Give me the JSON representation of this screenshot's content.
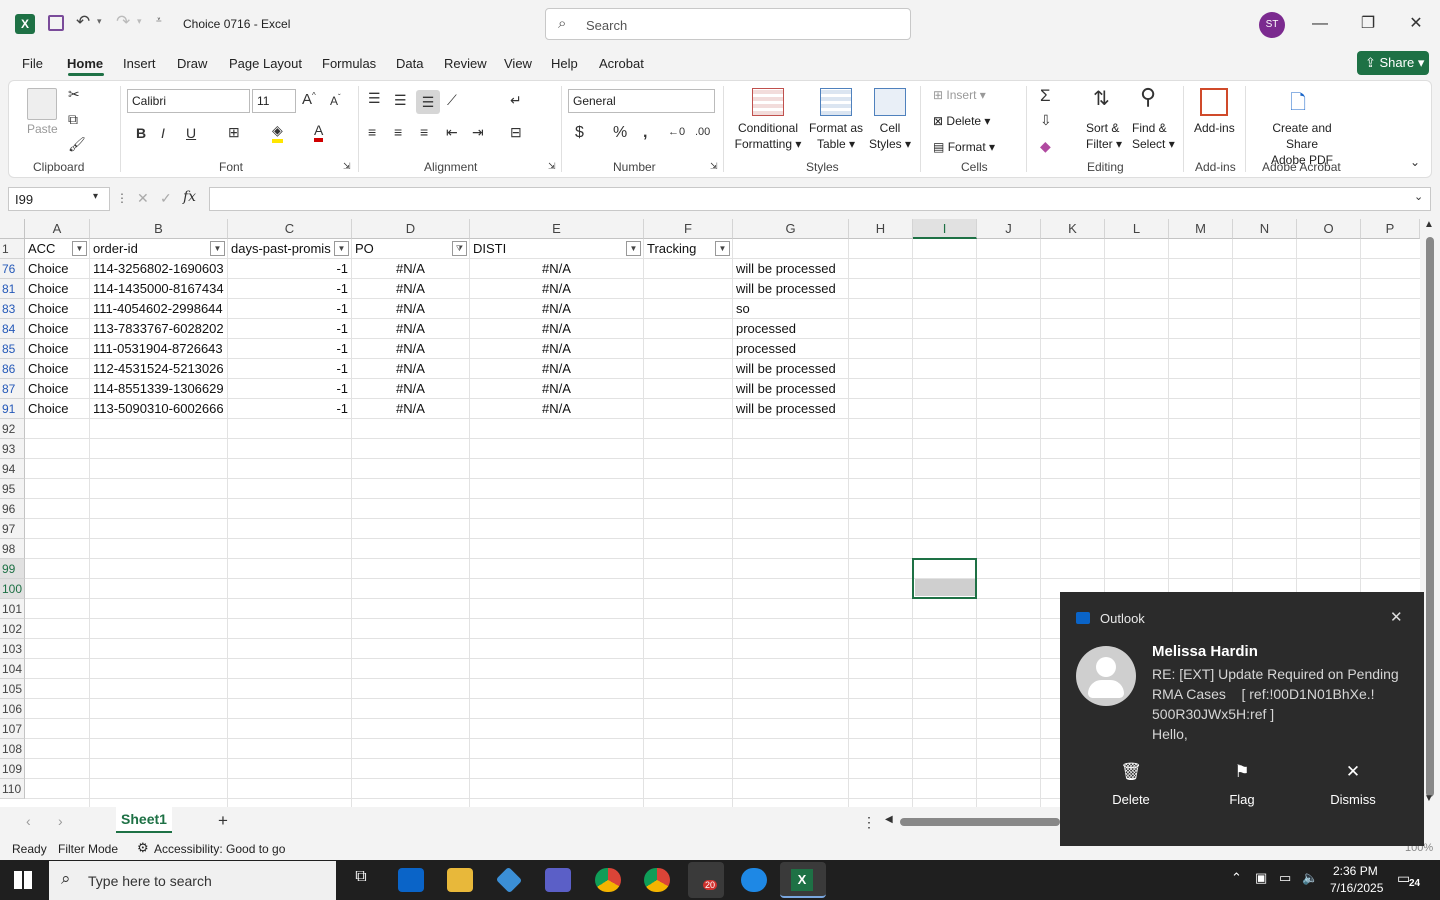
{
  "window": {
    "title": "Choice 0716  -  Excel",
    "search_placeholder": "Search",
    "user_initials": "ST"
  },
  "menu": {
    "tabs": [
      "File",
      "Home",
      "Insert",
      "Draw",
      "Page Layout",
      "Formulas",
      "Data",
      "Review",
      "View",
      "Help",
      "Acrobat"
    ],
    "share": "Share"
  },
  "ribbon": {
    "clipboard": {
      "paste": "Paste",
      "group": "Clipboard"
    },
    "font": {
      "name": "Calibri",
      "size": "11",
      "group": "Font"
    },
    "alignment": {
      "group": "Alignment"
    },
    "number": {
      "format": "General",
      "group": "Number"
    },
    "styles": {
      "conditional_1": "Conditional",
      "conditional_2": "Formatting",
      "format_table_1": "Format as",
      "format_table_2": "Table",
      "cell_styles_1": "Cell",
      "cell_styles_2": "Styles",
      "group": "Styles"
    },
    "cells": {
      "insert": "Insert",
      "delete": "Delete",
      "format": "Format",
      "group": "Cells"
    },
    "editing": {
      "sort_1": "Sort &",
      "sort_2": "Filter",
      "find_1": "Find &",
      "find_2": "Select",
      "group": "Editing"
    },
    "addins": {
      "label": "Add-ins",
      "group": "Add-ins"
    },
    "acrobat": {
      "label_1": "Create and Share",
      "label_2": "Adobe PDF",
      "group": "Adobe Acrobat"
    }
  },
  "formula_bar": {
    "name_box": "I99",
    "fx": "fx",
    "formula": ""
  },
  "columns": [
    "A",
    "B",
    "C",
    "D",
    "E",
    "F",
    "G",
    "H",
    "I",
    "J",
    "K",
    "L",
    "M",
    "N",
    "O",
    "P"
  ],
  "header_row": {
    "row": "1",
    "A": "ACC",
    "B": "order-id",
    "C": "days-past-promis",
    "D": "PO",
    "E": "DISTI",
    "F": "Tracking",
    "G": ""
  },
  "rows": [
    {
      "row": "76",
      "A": "Choice",
      "B": "114-3256802-1690603",
      "C": "-1",
      "D": "#N/A",
      "E": "#N/A",
      "F": "",
      "G": "will be processed"
    },
    {
      "row": "81",
      "A": "Choice",
      "B": "114-1435000-8167434",
      "C": "-1",
      "D": "#N/A",
      "E": "#N/A",
      "F": "",
      "G": "will be processed"
    },
    {
      "row": "83",
      "A": "Choice",
      "B": "111-4054602-2998644",
      "C": "-1",
      "D": "#N/A",
      "E": "#N/A",
      "F": "",
      "G": "so"
    },
    {
      "row": "84",
      "A": "Choice",
      "B": "113-7833767-6028202",
      "C": "-1",
      "D": "#N/A",
      "E": "#N/A",
      "F": "",
      "G": "processed"
    },
    {
      "row": "85",
      "A": "Choice",
      "B": "111-0531904-8726643",
      "C": "-1",
      "D": "#N/A",
      "E": "#N/A",
      "F": "",
      "G": "processed"
    },
    {
      "row": "86",
      "A": "Choice",
      "B": "112-4531524-5213026",
      "C": "-1",
      "D": "#N/A",
      "E": "#N/A",
      "F": "",
      "G": "will be processed"
    },
    {
      "row": "87",
      "A": "Choice",
      "B": "114-8551339-1306629",
      "C": "-1",
      "D": "#N/A",
      "E": "#N/A",
      "F": "",
      "G": "will be processed"
    },
    {
      "row": "91",
      "A": "Choice",
      "B": "113-5090310-6002666",
      "C": "-1",
      "D": "#N/A",
      "E": "#N/A",
      "F": "",
      "G": "will be processed"
    }
  ],
  "empty_rows": [
    "92",
    "93",
    "94",
    "95",
    "96",
    "97",
    "98",
    "99",
    "100",
    "101",
    "102",
    "103",
    "104",
    "105",
    "106",
    "107",
    "108",
    "109",
    "110"
  ],
  "sheets": {
    "active": "Sheet1",
    "add": "+"
  },
  "status": {
    "ready": "Ready",
    "filter_mode": "Filter Mode",
    "accessibility": "Accessibility: Good to go",
    "zoom": "100%"
  },
  "notification": {
    "app": "Outlook",
    "sender": "Melissa Hardin",
    "line1": "RE: [EXT] Update Required on Pending",
    "line2": "RMA Cases    [ ref:!00D1N01BhXe.!",
    "line3": "500R30JWx5H:ref ]",
    "line4": "Hello,",
    "actions": {
      "delete": "Delete",
      "flag": "Flag",
      "dismiss": "Dismiss"
    }
  },
  "taskbar": {
    "search_placeholder": "Type here to search",
    "time": "2:36 PM",
    "date": "7/16/2025",
    "notifications_count": "24",
    "zoom_badge": "20"
  },
  "colors": {
    "excel_green": "#1e7145",
    "filtered_row_blue": "#2458b8",
    "toast_bg": "#2b2b2b",
    "taskbar_bg": "#1f1f1f"
  }
}
